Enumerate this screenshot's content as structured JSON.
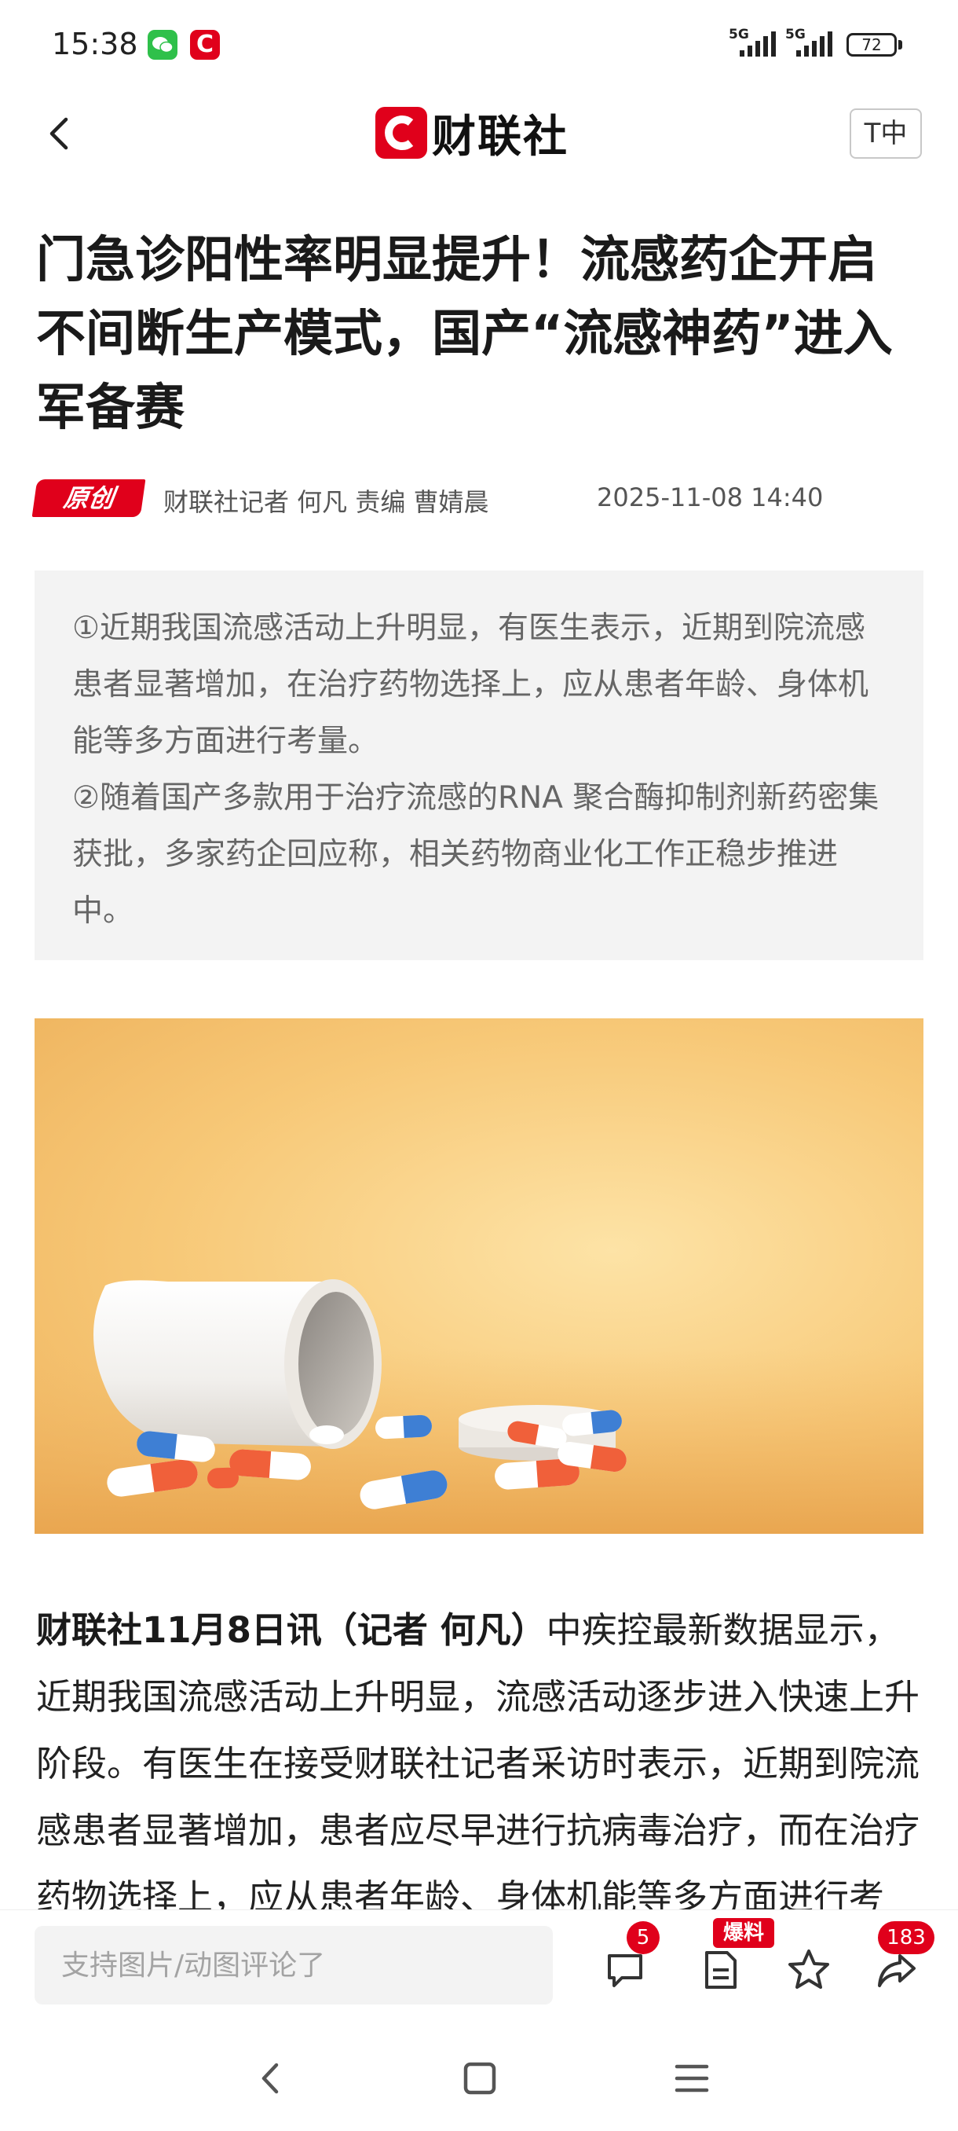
{
  "status_bar": {
    "time": "15:38",
    "cls_app_letter": "C",
    "signal_1": "5G",
    "signal_2": "5G",
    "battery": "72"
  },
  "header": {
    "logo_text": "财联社",
    "font_size_button": "T中"
  },
  "article": {
    "title": "门急诊阳性率明显提升！流感药企开启不间断生产模式，国产“流感神药”进入军备赛",
    "badge": "原创",
    "author_line": "财联社记者 何凡  责编 曹婧晨",
    "datetime": "2025-11-08 14:40",
    "summary": [
      "①近期我国流感活动上升明显，有医生表示，近期到院流感患者显著增加，在治疗药物选择上，应从患者年龄、身体机能等多方面进行考量。",
      "②随着国产多款用于治疗流感的RNA 聚合酶抑制剂新药密集获批，多家药企回应称，相关药物商业化工作正稳步推进中。"
    ],
    "body_lead": "财联社11月8日讯（记者 何凡）",
    "body": "中疾控最新数据显示，近期我国流感活动上升明显，流感活动逐步进入快速上升阶段。有医生在接受财联社记者采访时表示，近期到院流感患者显著增加，患者应尽早进行抗病毒治疗，而在治疗药物选择上，应从患者年龄、身体机能等多方面进行考量。"
  },
  "comment_bar": {
    "placeholder": "支持图片/动图评论了",
    "comment_count": "5",
    "tip_label": "爆料",
    "share_count": "183"
  },
  "colors": {
    "brand_red": "#e0001b",
    "summary_bg": "#f3f3f3"
  },
  "icons": [
    "back-icon",
    "comment-icon",
    "report-icon",
    "star-icon",
    "share-icon",
    "nav-back-icon",
    "nav-home-icon",
    "nav-menu-icon"
  ]
}
